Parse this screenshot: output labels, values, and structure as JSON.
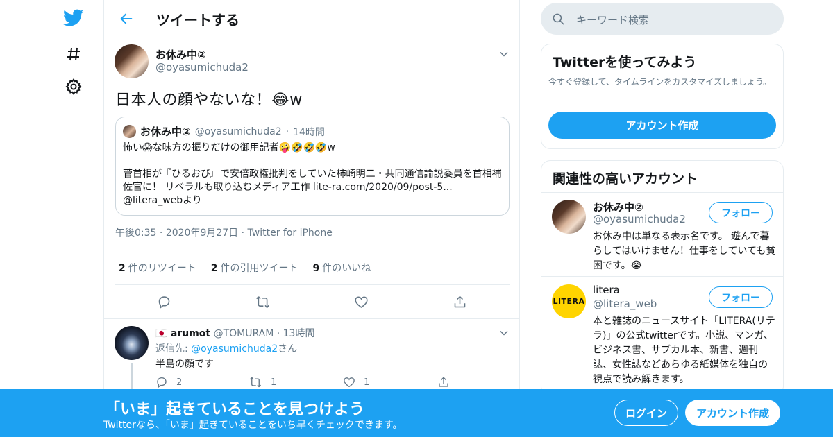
{
  "colors": {
    "accent": "#1da1f2",
    "text": "#14171a",
    "muted": "#657786",
    "border": "#e6ecf0"
  },
  "nav": {
    "icons": [
      "twitter-logo-icon",
      "hashtag-icon",
      "gear-icon"
    ]
  },
  "header": {
    "title": "ツイートする"
  },
  "tweet": {
    "name": "お休み中②",
    "handle": "@oyasumichuda2",
    "text": "日本人の顔やないな！😂w",
    "quote": {
      "name": "お休み中②",
      "handle": "@oyasumichuda2",
      "time": "14時間",
      "line1": "怖い😱な味方の振りだけの御用記者🤪🤣🤣🤣w",
      "line2": "菅首相が『ひるおび』で安倍政権批判をしていた柿崎明二・共同通信論説委員を首相補佐官に！ リベラルも取り込むメディア工作 lite-ra.com/2020/09/post-5...",
      "line3": "@litera_webより"
    },
    "time": "午後0:35",
    "date": "2020年9月27日",
    "source": "Twitter for iPhone",
    "stats": [
      {
        "count": "2",
        "label": "件のリツイート"
      },
      {
        "count": "2",
        "label": "件の引用ツイート"
      },
      {
        "count": "9",
        "label": "件のいいね"
      }
    ]
  },
  "reply": {
    "flag": "🇯🇵",
    "name": "arumot",
    "handle": "@TOMURAM",
    "time": "13時間",
    "replying_prefix": "返信先: ",
    "replying_to": "@oyasumichuda2",
    "replying_suffix": "さん",
    "text": "半島の顔です",
    "reply_count": "2",
    "retweet_count": "1",
    "like_count": "1"
  },
  "search": {
    "placeholder": "キーワード検索"
  },
  "signup_card": {
    "title": "Twitterを使ってみよう",
    "description": "今すぐ登録して、タイムラインをカスタマイズしましょう。",
    "button": "アカウント作成"
  },
  "related": {
    "title": "関連性の高いアカウント",
    "accounts": [
      {
        "name": "お休み中②",
        "handle": "@oyasumichuda2",
        "follow": "フォロー",
        "bio": "お休み中は単なる表示名です。 遊んで暮らしてはいけません！仕事をしていても貧困です。😭"
      },
      {
        "name": "litera",
        "handle": "@litera_web",
        "follow": "フォロー",
        "logo_text": "LITERA",
        "bio": "本と雑誌のニュースサイト「LITERA(リテラ)」の公式twitterです。小説、マンガ、ビジネス書、サブカル本、新書、週刊誌、女性誌などあらゆる紙媒体を独自の視点で読み解きます。"
      }
    ]
  },
  "banner": {
    "title": "「いま」起きていることを見つけよう",
    "subtitle": "Twitterなら、「いま」起きていることをいち早くチェックできます。",
    "login": "ログイン",
    "signup": "アカウント作成"
  }
}
